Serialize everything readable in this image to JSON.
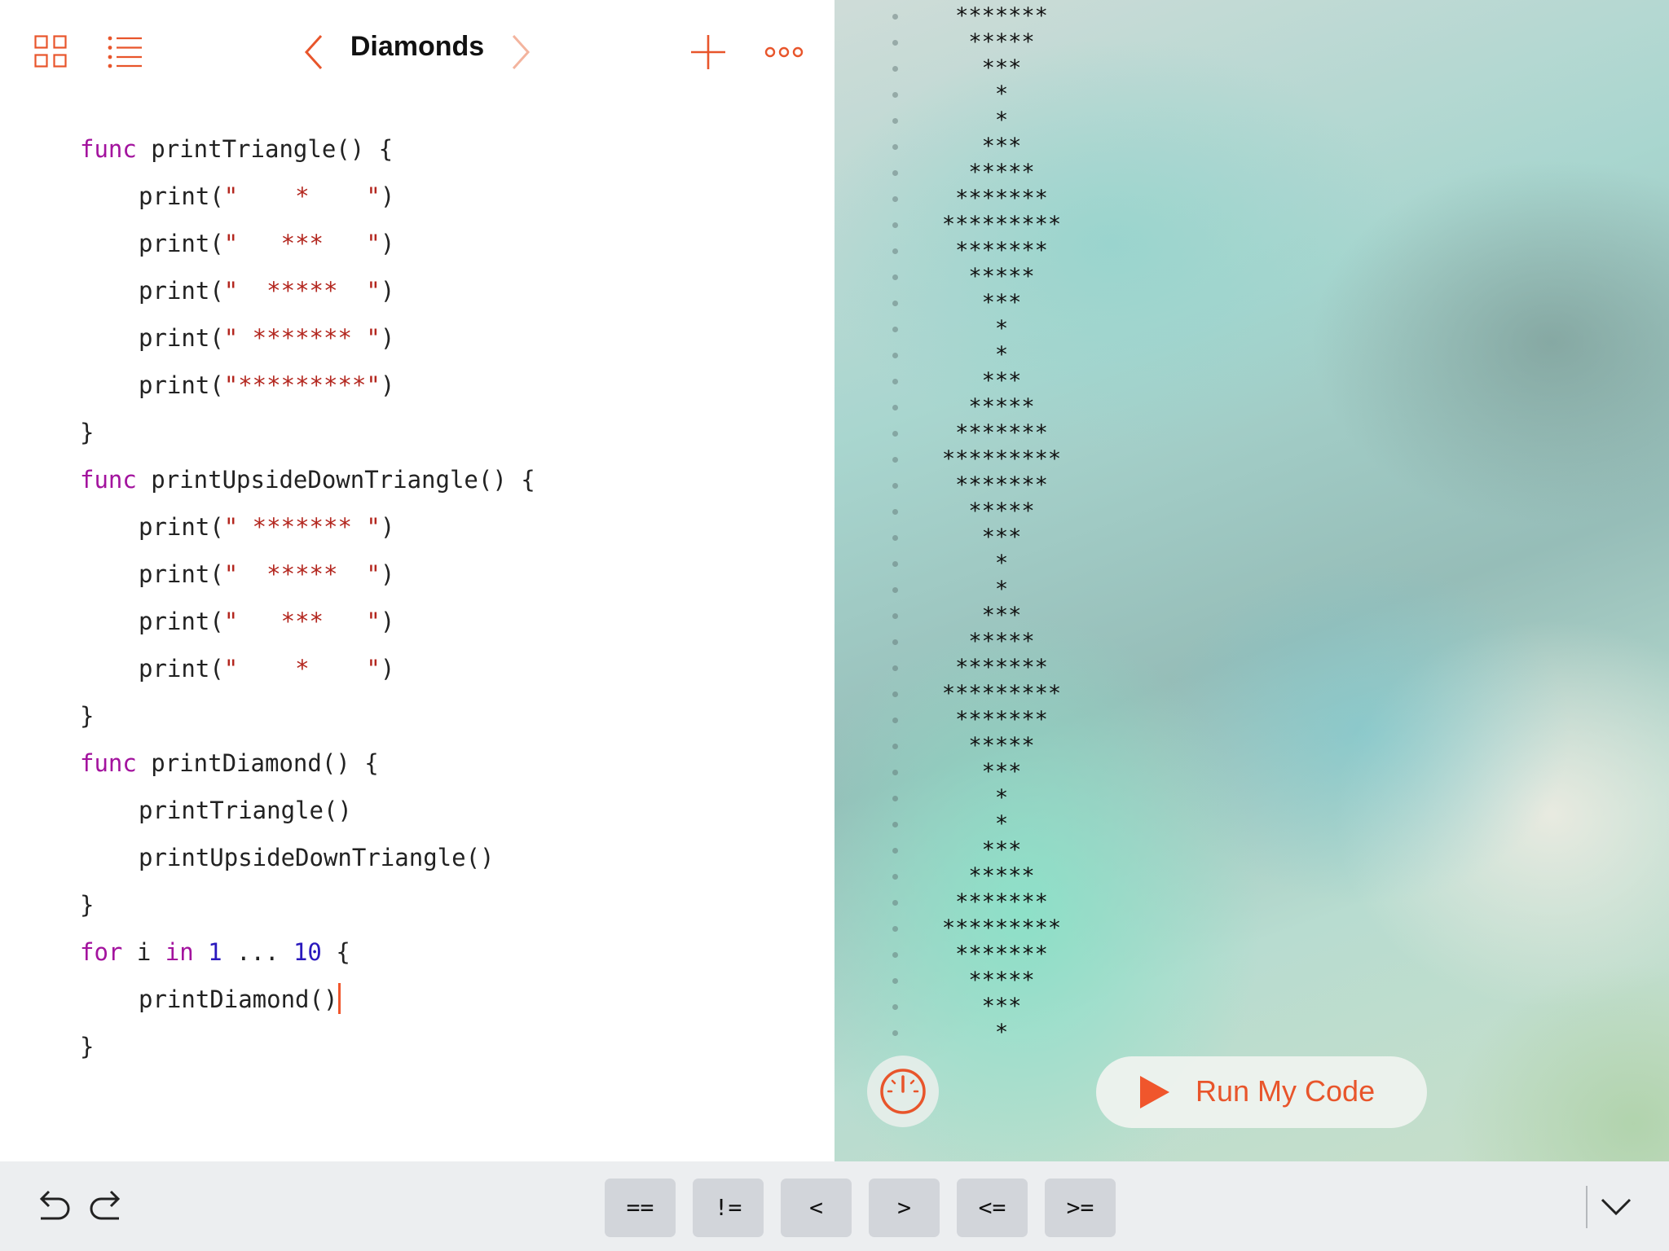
{
  "toolbar": {
    "title": "Diamonds",
    "icons": [
      "grid-icon",
      "list-icon",
      "chevron-left-icon",
      "chevron-right-icon",
      "plus-icon",
      "more-icon"
    ],
    "accent_color": "#e8552b"
  },
  "editor": {
    "lines": [
      {
        "indent": false,
        "tokens": [
          {
            "t": "kw",
            "v": "func"
          },
          {
            "t": "pl",
            "v": " printTriangle() {"
          }
        ]
      },
      {
        "indent": true,
        "tokens": [
          {
            "t": "pl",
            "v": "print("
          },
          {
            "t": "str",
            "v": "\"    *    \""
          },
          {
            "t": "pl",
            "v": ")"
          }
        ]
      },
      {
        "indent": true,
        "tokens": [
          {
            "t": "pl",
            "v": "print("
          },
          {
            "t": "str",
            "v": "\"   ***   \""
          },
          {
            "t": "pl",
            "v": ")"
          }
        ]
      },
      {
        "indent": true,
        "tokens": [
          {
            "t": "pl",
            "v": "print("
          },
          {
            "t": "str",
            "v": "\"  *****  \""
          },
          {
            "t": "pl",
            "v": ")"
          }
        ]
      },
      {
        "indent": true,
        "tokens": [
          {
            "t": "pl",
            "v": "print("
          },
          {
            "t": "str",
            "v": "\" ******* \""
          },
          {
            "t": "pl",
            "v": ")"
          }
        ]
      },
      {
        "indent": true,
        "tokens": [
          {
            "t": "pl",
            "v": "print("
          },
          {
            "t": "str",
            "v": "\"*********\""
          },
          {
            "t": "pl",
            "v": ")"
          }
        ]
      },
      {
        "indent": false,
        "tokens": [
          {
            "t": "pl",
            "v": "}"
          }
        ]
      },
      {
        "indent": false,
        "tokens": [
          {
            "t": "kw",
            "v": "func"
          },
          {
            "t": "pl",
            "v": " printUpsideDownTriangle() {"
          }
        ]
      },
      {
        "indent": true,
        "tokens": [
          {
            "t": "pl",
            "v": "print("
          },
          {
            "t": "str",
            "v": "\" ******* \""
          },
          {
            "t": "pl",
            "v": ")"
          }
        ]
      },
      {
        "indent": true,
        "tokens": [
          {
            "t": "pl",
            "v": "print("
          },
          {
            "t": "str",
            "v": "\"  *****  \""
          },
          {
            "t": "pl",
            "v": ")"
          }
        ]
      },
      {
        "indent": true,
        "tokens": [
          {
            "t": "pl",
            "v": "print("
          },
          {
            "t": "str",
            "v": "\"   ***   \""
          },
          {
            "t": "pl",
            "v": ")"
          }
        ]
      },
      {
        "indent": true,
        "tokens": [
          {
            "t": "pl",
            "v": "print("
          },
          {
            "t": "str",
            "v": "\"    *    \""
          },
          {
            "t": "pl",
            "v": ")"
          }
        ]
      },
      {
        "indent": false,
        "tokens": [
          {
            "t": "pl",
            "v": "}"
          }
        ]
      },
      {
        "indent": false,
        "tokens": [
          {
            "t": "kw",
            "v": "func"
          },
          {
            "t": "pl",
            "v": " printDiamond() {"
          }
        ]
      },
      {
        "indent": true,
        "tokens": [
          {
            "t": "pl",
            "v": "printTriangle()"
          }
        ]
      },
      {
        "indent": true,
        "tokens": [
          {
            "t": "pl",
            "v": "printUpsideDownTriangle()"
          }
        ]
      },
      {
        "indent": false,
        "tokens": [
          {
            "t": "pl",
            "v": "}"
          }
        ]
      },
      {
        "indent": false,
        "tokens": [
          {
            "t": "kw",
            "v": "for"
          },
          {
            "t": "pl",
            "v": " i "
          },
          {
            "t": "kw",
            "v": "in"
          },
          {
            "t": "pl",
            "v": " "
          },
          {
            "t": "num",
            "v": "1"
          },
          {
            "t": "pl",
            "v": " ... "
          },
          {
            "t": "num",
            "v": "10"
          },
          {
            "t": "pl",
            "v": " {"
          }
        ]
      },
      {
        "indent": true,
        "tokens": [
          {
            "t": "pl",
            "v": "printDiamond()"
          }
        ],
        "cursor": true
      },
      {
        "indent": false,
        "tokens": [
          {
            "t": "pl",
            "v": "}"
          }
        ]
      }
    ]
  },
  "console": {
    "lines": [
      "*******",
      "*****",
      "***",
      "*",
      "*",
      "***",
      "*****",
      "*******",
      "*********",
      "*******",
      "*****",
      "***",
      "*",
      "*",
      "***",
      "*****",
      "*******",
      "*********",
      "*******",
      "*****",
      "***",
      "*",
      "*",
      "***",
      "*****",
      "*******",
      "*********",
      "*******",
      "*****",
      "***",
      "*",
      "*",
      "***",
      "*****",
      "*******",
      "*********",
      "*******",
      "*****",
      "***",
      "*"
    ]
  },
  "run": {
    "label": "Run My Code",
    "icon": "play-icon"
  },
  "speed": {
    "icon": "speedometer-icon"
  },
  "shortcuts": {
    "keys": [
      "==",
      "!=",
      "<",
      ">",
      "<=",
      ">="
    ],
    "undo_icon": "undo-icon",
    "redo_icon": "redo-icon",
    "dismiss_icon": "chevron-down-icon"
  }
}
